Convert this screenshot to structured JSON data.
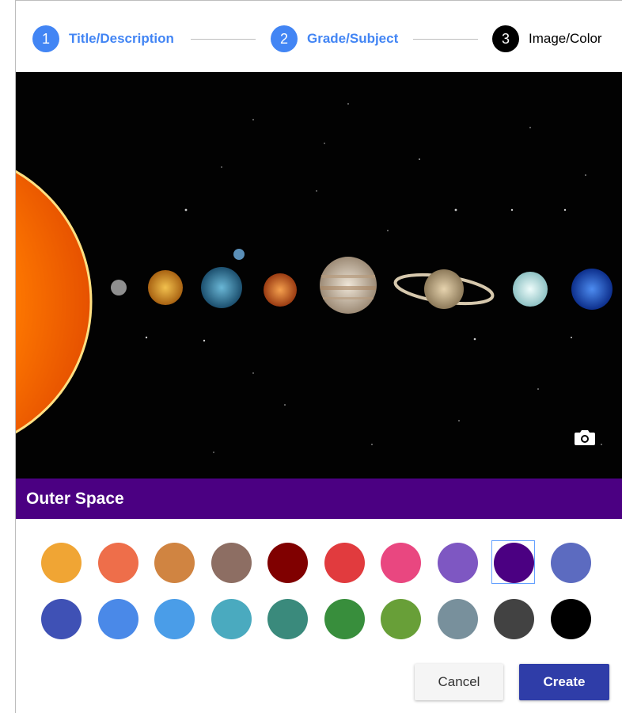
{
  "stepper": {
    "steps": [
      {
        "number": "1",
        "label": "Title/Description",
        "state": "done"
      },
      {
        "number": "2",
        "label": "Grade/Subject",
        "state": "done"
      },
      {
        "number": "3",
        "label": "Image/Color",
        "state": "active"
      }
    ]
  },
  "banner": {
    "planets": [
      "Mercury",
      "Venus",
      "Earth",
      "Mars",
      "Jupiter",
      "Saturn",
      "Uranus",
      "Neptune"
    ],
    "camera_icon": "camera-icon"
  },
  "title_bar": {
    "text": "Outer Space",
    "color": "#4b0082"
  },
  "swatches": {
    "selected_index": 8,
    "colors": [
      "#f0a534",
      "#ee6e4a",
      "#d08441",
      "#8d6e63",
      "#800000",
      "#e13b3e",
      "#e94780",
      "#7e57c2",
      "#4b0082",
      "#5c6bc0",
      "#3f51b5",
      "#4a89e8",
      "#4a9de8",
      "#4aaabf",
      "#3a8a7c",
      "#388e3c",
      "#689f38",
      "#78909c",
      "#424242",
      "#000000"
    ]
  },
  "buttons": {
    "cancel": "Cancel",
    "create": "Create"
  }
}
